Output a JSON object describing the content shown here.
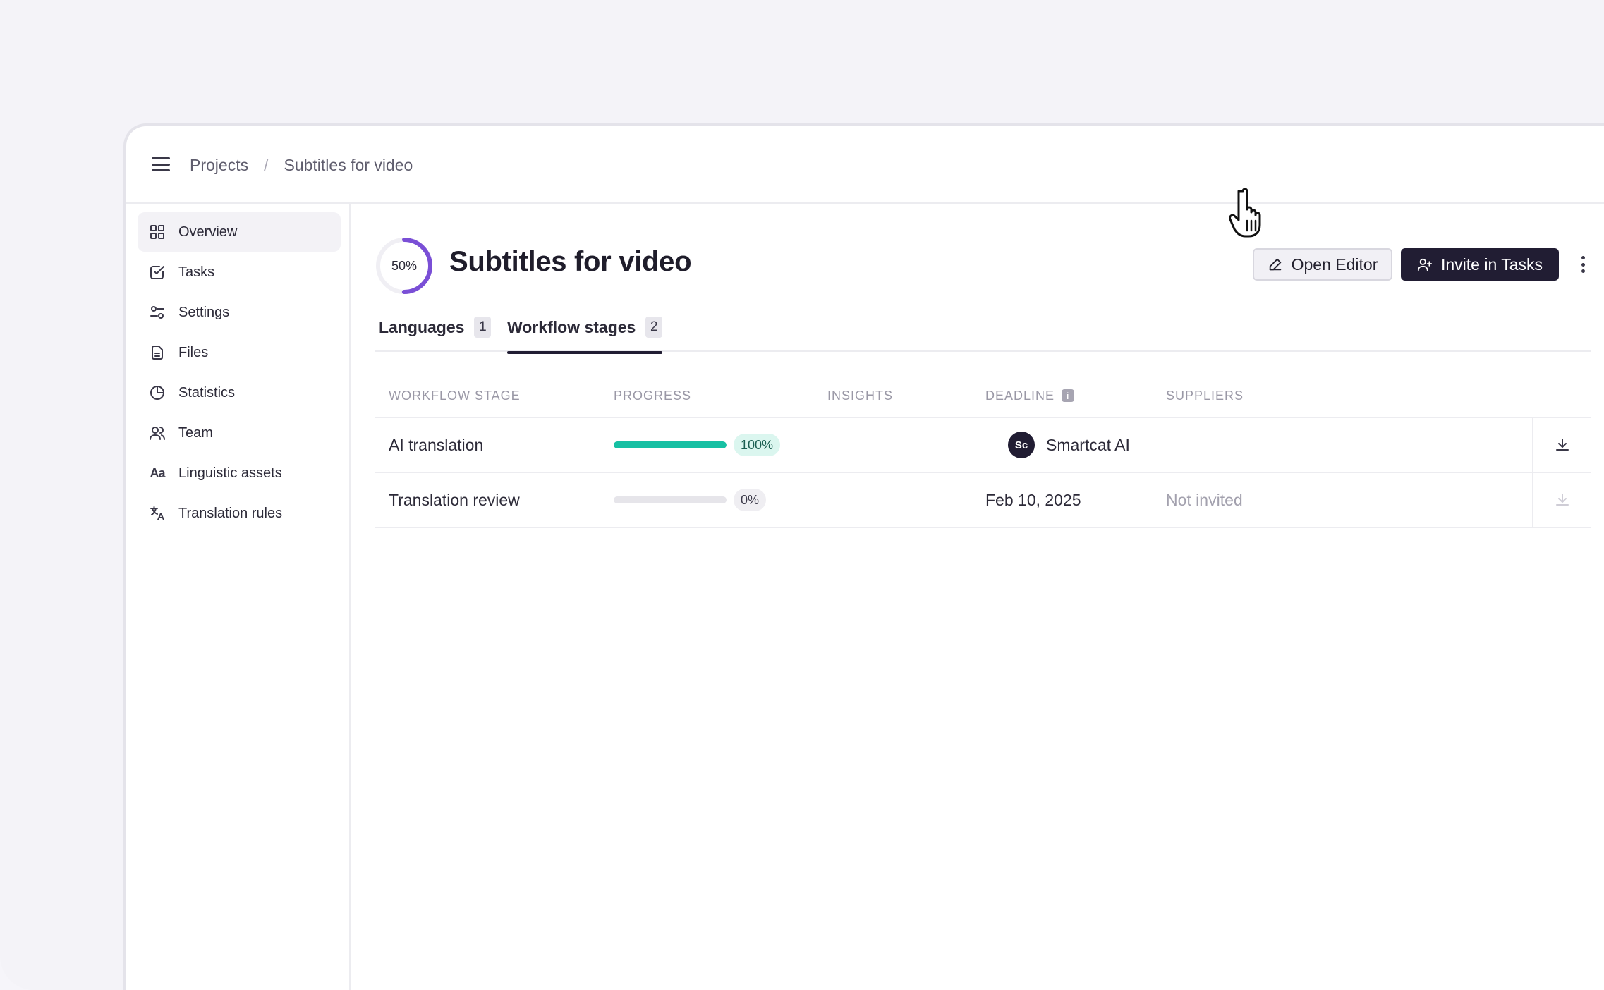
{
  "breadcrumb": {
    "root": "Projects",
    "separator": "/",
    "current": "Subtitles for video"
  },
  "sidebar": {
    "items": [
      {
        "label": "Overview",
        "icon": "grid-icon",
        "active": true
      },
      {
        "label": "Tasks",
        "icon": "check-square-icon"
      },
      {
        "label": "Settings",
        "icon": "sliders-icon"
      },
      {
        "label": "Files",
        "icon": "file-icon"
      },
      {
        "label": "Statistics",
        "icon": "pie-chart-icon"
      },
      {
        "label": "Team",
        "icon": "users-icon"
      },
      {
        "label": "Linguistic assets",
        "icon": "aa-icon",
        "icon_text": "Aa"
      },
      {
        "label": "Translation rules",
        "icon": "translate-icon"
      }
    ]
  },
  "project": {
    "title": "Subtitles for video",
    "progress": 0.5,
    "progress_label": "50%"
  },
  "actions": {
    "open_editor": "Open Editor",
    "invite_in_tasks": "Invite in Tasks"
  },
  "tabs": [
    {
      "label": "Languages",
      "count": "1",
      "active": false
    },
    {
      "label": "Workflow stages",
      "count": "2",
      "active": true
    }
  ],
  "table": {
    "headers": {
      "stage": "WORKFLOW STAGE",
      "progress": "PROGRESS",
      "insights": "INSIGHTS",
      "deadline": "DEADLINE",
      "suppliers": "SUPPLIERS",
      "deadline_info_icon": "i"
    },
    "rows": [
      {
        "stage": "AI translation",
        "progress": 1.0,
        "progress_label": "100%",
        "deadline": "",
        "supplier": "Smartcat AI",
        "supplier_avatar": "Sc",
        "download_enabled": true
      },
      {
        "stage": "Translation review",
        "progress": 0.0,
        "progress_label": "0%",
        "deadline": "Feb 10, 2025",
        "supplier": "Not invited",
        "download_enabled": false
      }
    ]
  },
  "colors": {
    "accent": "#7a4fd6",
    "progress_done": "#16c0a3",
    "primary_button": "#211d33"
  }
}
